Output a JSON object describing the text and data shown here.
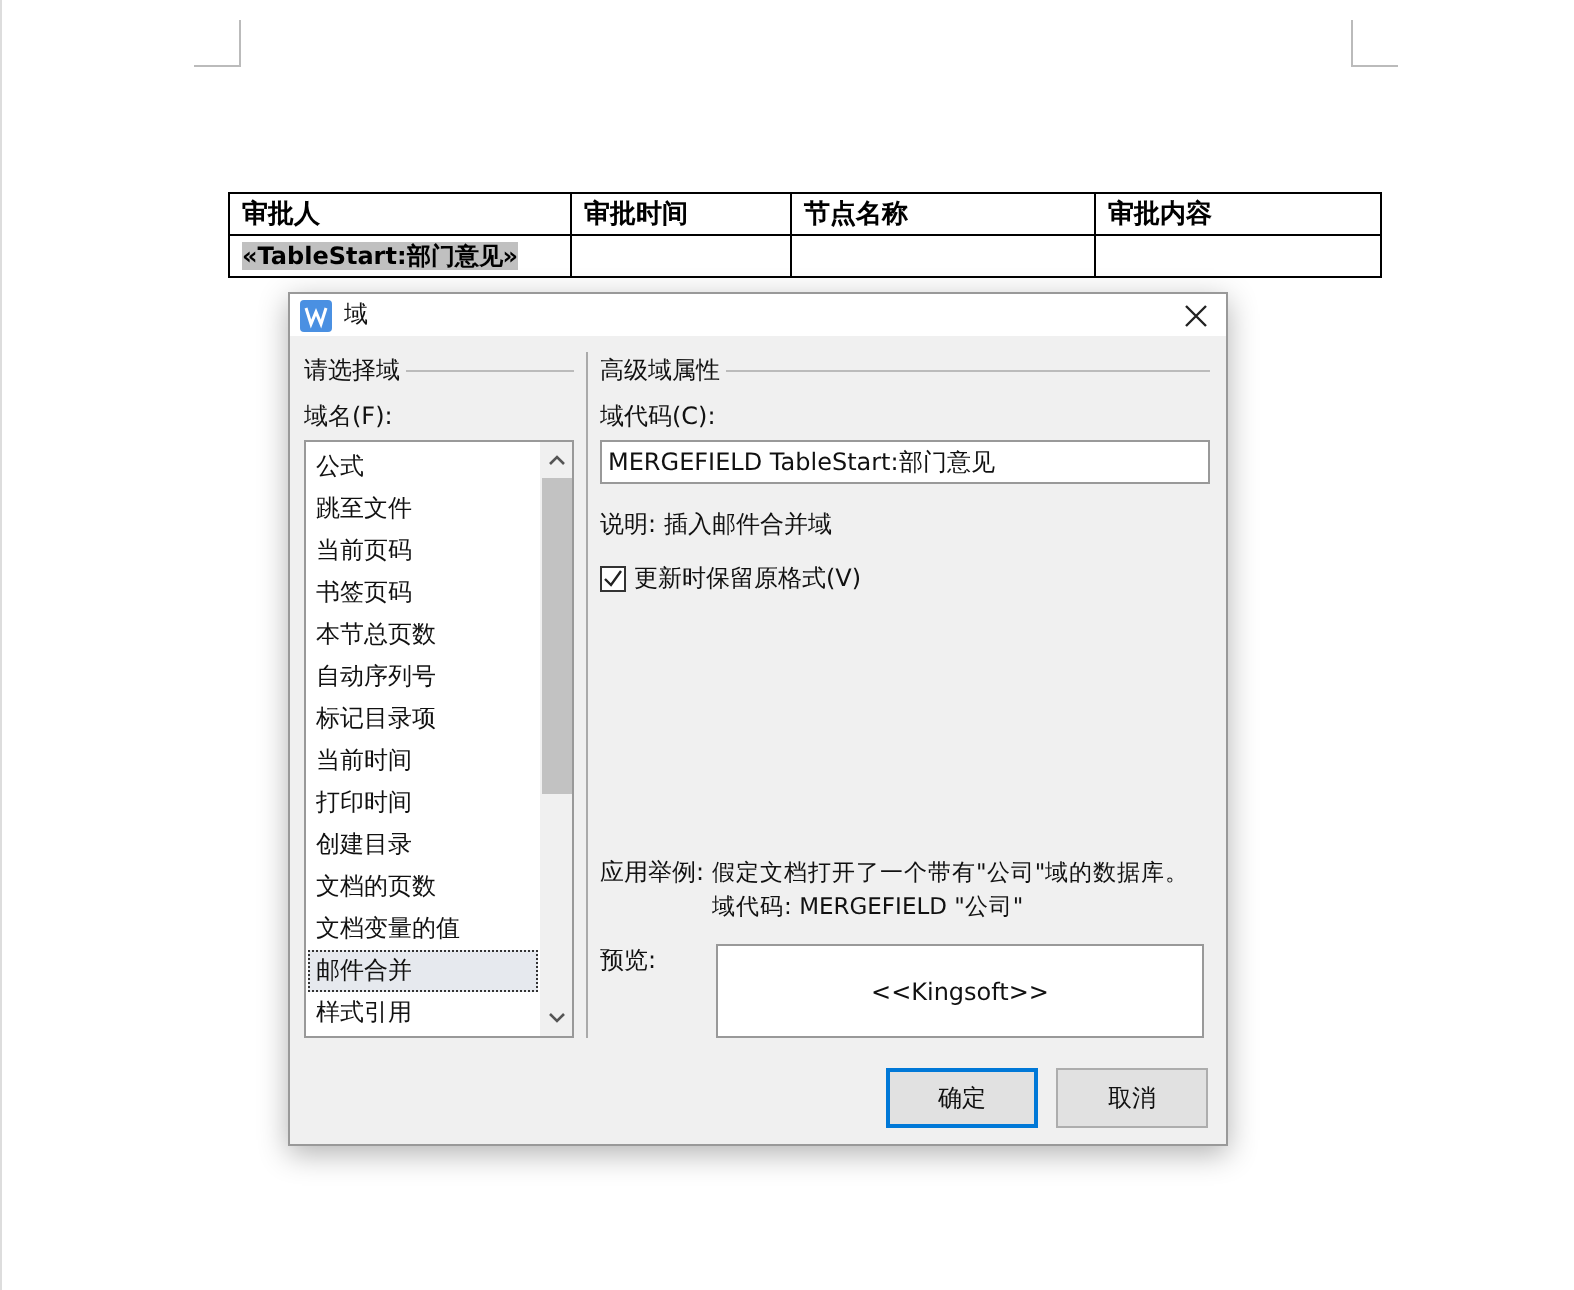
{
  "document": {
    "table": {
      "columns": [
        "审批人",
        "审批时间",
        "节点名称",
        "审批内容"
      ],
      "rows": [
        [
          "«TableStart:部门意见»",
          "",
          "",
          ""
        ]
      ]
    }
  },
  "dialog": {
    "title": "域",
    "left_group": {
      "title": "请选择域",
      "list_label": "域名(F):",
      "items": [
        {
          "label": "公式",
          "selected": false
        },
        {
          "label": "跳至文件",
          "selected": false
        },
        {
          "label": "当前页码",
          "selected": false
        },
        {
          "label": "书签页码",
          "selected": false
        },
        {
          "label": "本节总页数",
          "selected": false
        },
        {
          "label": "自动序列号",
          "selected": false
        },
        {
          "label": "标记目录项",
          "selected": false
        },
        {
          "label": "当前时间",
          "selected": false
        },
        {
          "label": "打印时间",
          "selected": false
        },
        {
          "label": "创建目录",
          "selected": false
        },
        {
          "label": "文档的页数",
          "selected": false
        },
        {
          "label": "文档变量的值",
          "selected": false
        },
        {
          "label": "邮件合并",
          "selected": true
        },
        {
          "label": "样式引用",
          "selected": false
        }
      ]
    },
    "right_group": {
      "title": "高级域属性",
      "code_label": "域代码(C):",
      "code_value": "MERGEFIELD TableStart:部门意见",
      "description": "说明: 插入邮件合并域",
      "keep_format": {
        "label": "更新时保留原格式(V)",
        "checked": true
      },
      "example_label": "应用举例:",
      "example_lines": [
        "假定文档打开了一个带有\"公司\"域的数据库。",
        "域代码:  MERGEFIELD \"公司\""
      ],
      "preview_label": "预览:",
      "preview_value": "<<Kingsoft>>"
    },
    "buttons": [
      {
        "label": "确定",
        "kind": "default"
      },
      {
        "label": "取消",
        "kind": "normal"
      }
    ]
  }
}
